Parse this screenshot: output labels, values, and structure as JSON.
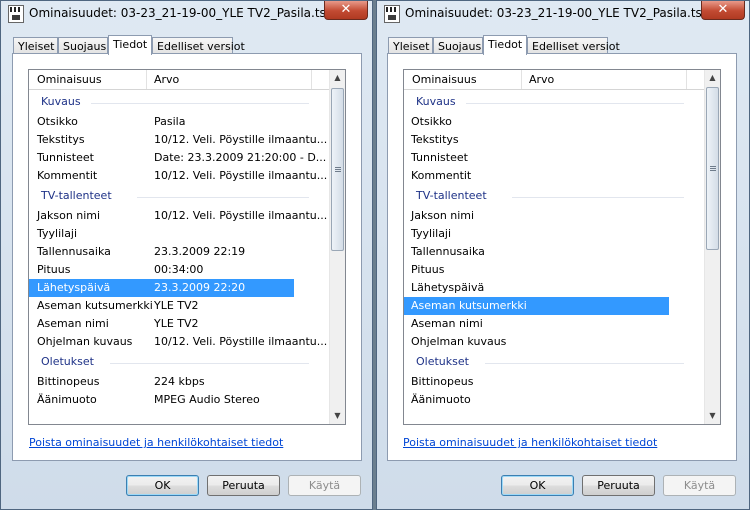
{
  "window_title": "Ominaisuudet: 03-23_21-19-00_YLE TV2_Pasila.ts",
  "close_glyph": "✕",
  "tabs": [
    "Yleiset",
    "Suojaus",
    "Tiedot",
    "Edelliset versiot"
  ],
  "active_tab": "Tiedot",
  "columns": {
    "name": "Ominaisuus",
    "value": "Arvo"
  },
  "left_list": {
    "groups": [
      {
        "title": "Kuvaus",
        "rows": [
          {
            "name": "Otsikko",
            "value": "Pasila"
          },
          {
            "name": "Tekstitys",
            "value": "10/12. Veli. Pöystille ilmaantu..."
          },
          {
            "name": "Tunnisteet",
            "value": "Date: 23.3.2009 21:20:00 - D..."
          },
          {
            "name": "Kommentit",
            "value": "10/12. Veli. Pöystille ilmaantu..."
          }
        ]
      },
      {
        "title": "TV-tallenteet",
        "rows": [
          {
            "name": "Jakson nimi",
            "value": "10/12. Veli. Pöystille ilmaantu..."
          },
          {
            "name": "Tyylilaji",
            "value": ""
          },
          {
            "name": "Tallennusaika",
            "value": "23.3.2009 22:19"
          },
          {
            "name": "Pituus",
            "value": "00:34:00"
          },
          {
            "name": "Lähetyspäivä",
            "value": "23.3.2009 22:20"
          },
          {
            "name": "Aseman kutsumerkki",
            "value": "YLE TV2"
          },
          {
            "name": "Aseman nimi",
            "value": "YLE TV2"
          },
          {
            "name": "Ohjelman kuvaus",
            "value": "10/12. Veli. Pöystille ilmaantu..."
          }
        ]
      },
      {
        "title": "Oletukset",
        "rows": [
          {
            "name": "Bittinopeus",
            "value": "224 kbps"
          },
          {
            "name": "Äänimuoto",
            "value": "MPEG Audio Stereo"
          }
        ]
      }
    ],
    "selected_row": "Lähetyspäivä"
  },
  "right_list": {
    "groups": [
      {
        "title": "Kuvaus",
        "rows": [
          {
            "name": "Otsikko",
            "value": ""
          },
          {
            "name": "Tekstitys",
            "value": ""
          },
          {
            "name": "Tunnisteet",
            "value": ""
          },
          {
            "name": "Kommentit",
            "value": ""
          }
        ]
      },
      {
        "title": "TV-tallenteet",
        "rows": [
          {
            "name": "Jakson nimi",
            "value": ""
          },
          {
            "name": "Tyylilaji",
            "value": ""
          },
          {
            "name": "Tallennusaika",
            "value": ""
          },
          {
            "name": "Pituus",
            "value": ""
          },
          {
            "name": "Lähetyspäivä",
            "value": ""
          },
          {
            "name": "Aseman kutsumerkki",
            "value": ""
          },
          {
            "name": "Aseman nimi",
            "value": ""
          },
          {
            "name": "Ohjelman kuvaus",
            "value": ""
          }
        ]
      },
      {
        "title": "Oletukset",
        "rows": [
          {
            "name": "Bittinopeus",
            "value": ""
          },
          {
            "name": "Äänimuoto",
            "value": ""
          }
        ]
      }
    ],
    "selected_row": "Aseman kutsumerkki"
  },
  "remove_link": "Poista ominaisuudet ja henkilökohtaiset tiedot",
  "buttons": {
    "ok": "OK",
    "cancel": "Peruuta",
    "apply": "Käytä"
  },
  "scroll_glyphs": {
    "up": "▲",
    "down": "▼"
  },
  "colors": {
    "selection": "#3399ff",
    "group_heading": "#1e3287",
    "link": "#0046d5",
    "close_button": "#c24a32"
  },
  "icons": {
    "title": "video-file-icon",
    "close": "close-icon",
    "scroll_up": "scroll-up-arrow-icon",
    "scroll_down": "scroll-down-arrow-icon"
  }
}
